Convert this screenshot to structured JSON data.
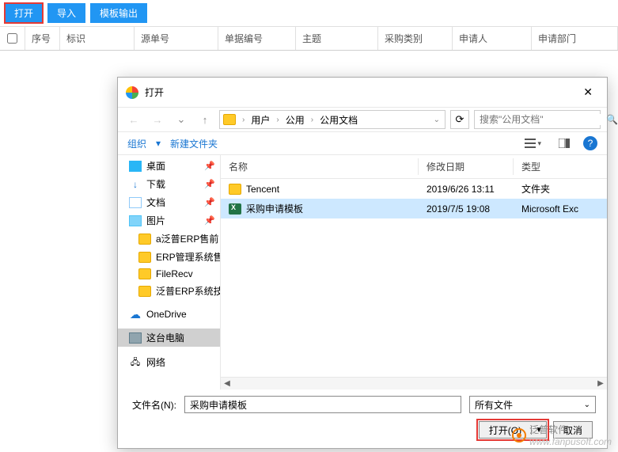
{
  "toolbar": {
    "open": "打开",
    "import": "导入",
    "template_export": "模板输出"
  },
  "grid": {
    "columns": [
      "序号",
      "标识",
      "源单号",
      "单据编号",
      "主题",
      "采购类别",
      "申请人",
      "申请部门"
    ]
  },
  "dialog": {
    "title": "打开",
    "breadcrumb": [
      "用户",
      "公用",
      "公用文档"
    ],
    "search_placeholder": "搜索\"公用文档\"",
    "organize": "组织",
    "new_folder": "新建文件夹",
    "tree": [
      {
        "label": "桌面",
        "ico": "desktop",
        "pinned": true
      },
      {
        "label": "下载",
        "ico": "download",
        "pinned": true
      },
      {
        "label": "文档",
        "ico": "doc",
        "pinned": true
      },
      {
        "label": "图片",
        "ico": "pic",
        "pinned": true
      },
      {
        "label": "a泛普ERP售前",
        "ico": "folder",
        "sub": true
      },
      {
        "label": "ERP管理系统售",
        "ico": "folder",
        "sub": true
      },
      {
        "label": "FileRecv",
        "ico": "folder",
        "sub": true
      },
      {
        "label": "泛普ERP系统技",
        "ico": "folder",
        "sub": true
      },
      {
        "label": "OneDrive",
        "ico": "cloud",
        "space_above": true
      },
      {
        "label": "这台电脑",
        "ico": "pc",
        "sel": true,
        "space_above": true
      },
      {
        "label": "网络",
        "ico": "net",
        "space_above": true
      }
    ],
    "file_headers": {
      "name": "名称",
      "date": "修改日期",
      "type": "类型"
    },
    "files": [
      {
        "name": "Tencent",
        "date": "2019/6/26 13:11",
        "type": "文件夹",
        "ico": "folder"
      },
      {
        "name": "采购申请模板",
        "date": "2019/7/5 19:08",
        "type": "Microsoft Exc",
        "ico": "xls",
        "sel": true
      }
    ],
    "filename_label": "文件名(N):",
    "filename_value": "采购申请模板",
    "filter": "所有文件",
    "btn_open": "打开(O)",
    "btn_cancel": "取消"
  },
  "watermark": {
    "brand": "泛普软件",
    "url": "www.fanpusoft.com"
  }
}
